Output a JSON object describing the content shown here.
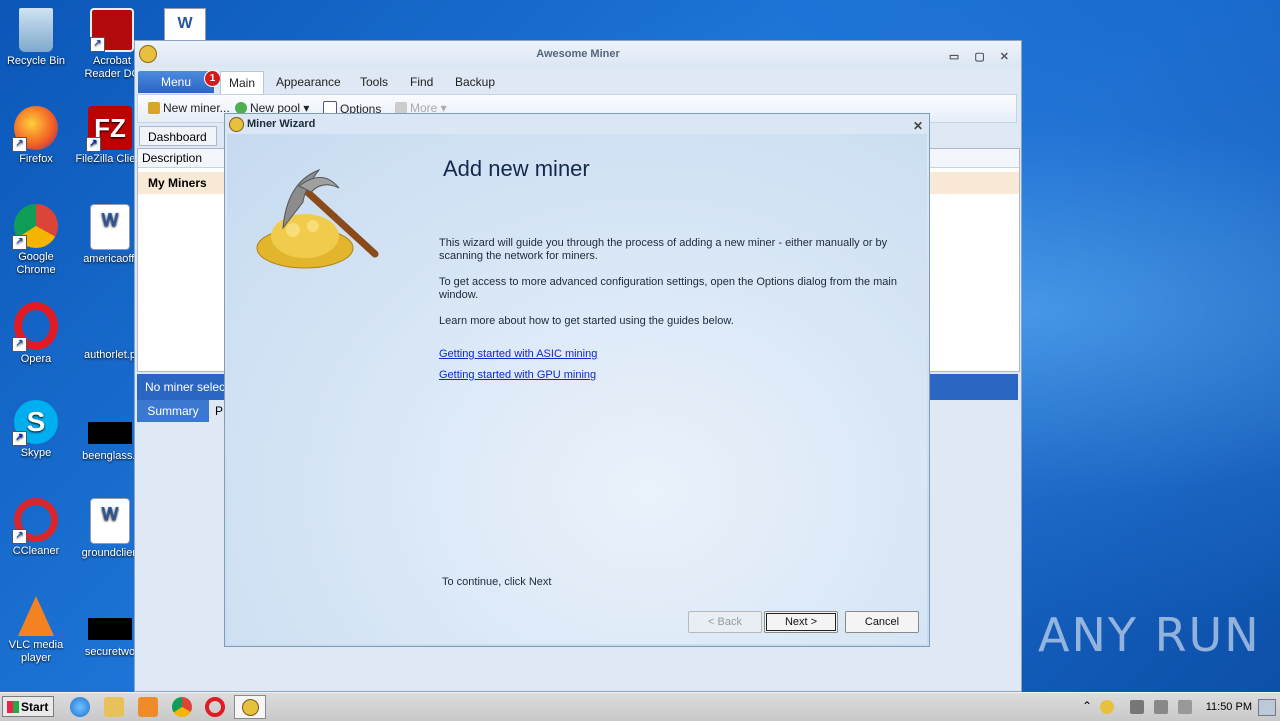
{
  "desktop": {
    "icons": [
      {
        "label": "Recycle Bin"
      },
      {
        "label": "Acrobat Reader DC"
      },
      {
        "label": "Firefox"
      },
      {
        "label": "FileZilla Client"
      },
      {
        "label": "Google Chrome"
      },
      {
        "label": "americaoffi"
      },
      {
        "label": "Opera"
      },
      {
        "label": "authorlet.p"
      },
      {
        "label": "Skype"
      },
      {
        "label": "beenglass.j"
      },
      {
        "label": "CCleaner"
      },
      {
        "label": "groundclien"
      },
      {
        "label": "VLC media player"
      },
      {
        "label": "securetwo"
      }
    ],
    "watermark": "ANY RUN"
  },
  "app": {
    "title": "Awesome Miner",
    "menu_label": "Menu",
    "menu_badge": "1",
    "tabs": [
      "Main",
      "Appearance",
      "Tools",
      "Find",
      "Backup"
    ],
    "toolbar": {
      "new_miner": "New miner...",
      "new_pool": "New pool",
      "options": "Options",
      "more": "More"
    },
    "dashboard_tab": "Dashboard",
    "column_header": "Description",
    "group_row": "My Miners",
    "status": "No miner selecte",
    "bottom_tabs": [
      "Summary",
      "P"
    ]
  },
  "wizard": {
    "title": "Miner Wizard",
    "heading": "Add new miner",
    "paragraph1": "This wizard will guide you through the process of adding a new miner - either manually or by scanning the network for miners.",
    "paragraph2": "To get access to more advanced configuration settings, open the Options dialog from the main window.",
    "paragraph3": "Learn more about how to get started using the guides below.",
    "link_asic": "Getting started with ASIC mining",
    "link_gpu": "Getting started with GPU mining",
    "continue_text": "To continue, click Next",
    "back_label": "< Back",
    "next_label": "Next >",
    "cancel_label": "Cancel"
  },
  "taskbar": {
    "start_label": "Start",
    "clock": "11:50 PM"
  }
}
